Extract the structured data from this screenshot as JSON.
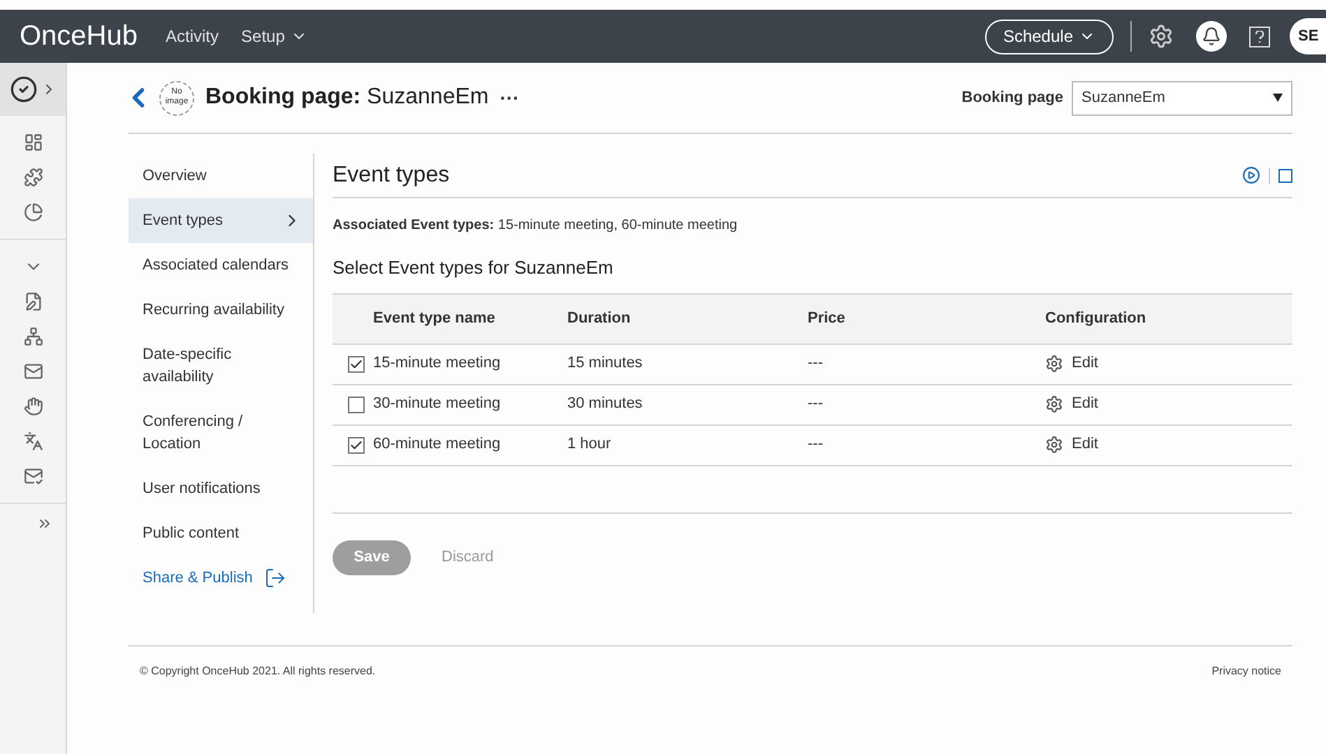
{
  "topbar": {
    "logo": "OnceHub",
    "menu": [
      {
        "label": "Activity",
        "dropdown": false
      },
      {
        "label": "Setup",
        "dropdown": true
      }
    ],
    "schedule_button": "Schedule",
    "avatar": "SE"
  },
  "header": {
    "avatar_text": "No image",
    "title": "**Booking page:** SuzanneEm",
    "more": "···",
    "selector_label": "Booking page",
    "selector_value": "SuzanneEm"
  },
  "nav": [
    {
      "label": "Overview",
      "selected": false,
      "kind": "item"
    },
    {
      "label": "Event types",
      "selected": true,
      "kind": "item"
    },
    {
      "label": "Associated calendars",
      "selected": false,
      "kind": "item"
    },
    {
      "label": "Recurring availability",
      "selected": false,
      "kind": "item"
    },
    {
      "label": "Date-specific availability",
      "selected": false,
      "kind": "item"
    },
    {
      "label": "Conferencing / Location",
      "selected": false,
      "kind": "item"
    },
    {
      "label": "User notifications",
      "selected": false,
      "kind": "item"
    },
    {
      "label": "Public content",
      "selected": false,
      "kind": "item"
    },
    {
      "label": "Share & Publish",
      "selected": false,
      "kind": "link"
    }
  ],
  "section": {
    "title": "Event types",
    "associated": "**Associated Event types:** 15-minute meeting, 60-minute meeting",
    "subtitle": "Select Event types for SuzanneEm"
  },
  "table": {
    "columns": [
      "Event type name",
      "Duration",
      "Price",
      "Configuration"
    ],
    "rows": [
      {
        "checked": true,
        "name": "15-minute meeting",
        "duration": "15 minutes",
        "price": "---",
        "action": "Edit"
      },
      {
        "checked": false,
        "name": "30-minute meeting",
        "duration": "30 minutes",
        "price": "---",
        "action": "Edit"
      },
      {
        "checked": true,
        "name": "60-minute meeting",
        "duration": "1 hour",
        "price": "---",
        "action": "Edit"
      }
    ]
  },
  "buttons": {
    "save": {
      "label": "Save",
      "disabled": true
    },
    "discard": "Discard"
  },
  "footer": {
    "copyright": "© Copyright OnceHub 2021. All rights reserved.",
    "privacy": "Privacy notice"
  }
}
